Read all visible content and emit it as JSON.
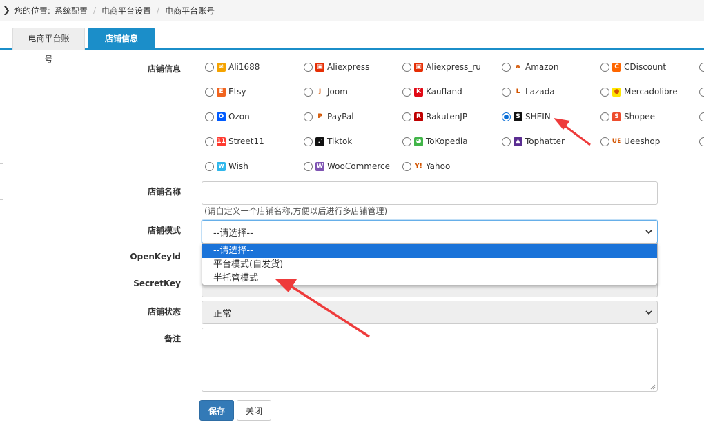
{
  "breadcrumb": {
    "prefix": "您的位置:",
    "items": [
      "系统配置",
      "电商平台设置",
      "电商平台账号"
    ]
  },
  "tabs": [
    {
      "label": "电商平台账号",
      "active": false
    },
    {
      "label": "店铺信息",
      "active": true,
      "close": "✖"
    }
  ],
  "form": {
    "platform_label": "店铺信息",
    "platforms": [
      {
        "name": "Ali1688",
        "icon": "ali1688-icon",
        "color": "#f5a300",
        "glyph": "≠"
      },
      {
        "name": "Aliexpress",
        "icon": "aliexpress-icon",
        "color": "#e62e04",
        "glyph": "▣"
      },
      {
        "name": "Aliexpress_ru",
        "icon": "aliexpress-ru-icon",
        "color": "#e62e04",
        "glyph": "▣"
      },
      {
        "name": "Amazon",
        "icon": "amazon-icon",
        "color": "#ffffff",
        "glyph": "a"
      },
      {
        "name": "CDiscount",
        "icon": "cdiscount-icon",
        "color": "#ff6600",
        "glyph": "C"
      },
      {
        "name": "Etsy",
        "icon": "etsy-icon",
        "color": "#f1641e",
        "glyph": "E"
      },
      {
        "name": "Joom",
        "icon": "joom-icon",
        "color": "#ffffff",
        "glyph": "J"
      },
      {
        "name": "Kaufland",
        "icon": "kaufland-icon",
        "color": "#e10915",
        "glyph": "K"
      },
      {
        "name": "Lazada",
        "icon": "lazada-icon",
        "color": "#ffffff",
        "glyph": "L"
      },
      {
        "name": "Mercadolibre",
        "icon": "mercadolibre-icon",
        "color": "#ffe600",
        "glyph": "●"
      },
      {
        "name": "Ozon",
        "icon": "ozon-icon",
        "color": "#005bff",
        "glyph": "O"
      },
      {
        "name": "PayPal",
        "icon": "paypal-icon",
        "color": "#ffffff",
        "glyph": "P"
      },
      {
        "name": "RakutenJP",
        "icon": "rakuten-icon",
        "color": "#bf0000",
        "glyph": "R"
      },
      {
        "name": "SHEIN",
        "icon": "shein-icon",
        "color": "#111111",
        "glyph": "S"
      },
      {
        "name": "Shopee",
        "icon": "shopee-icon",
        "color": "#ee4d2d",
        "glyph": "S"
      },
      {
        "name": "Street11",
        "icon": "street11-icon",
        "color": "#ff3b30",
        "glyph": "11"
      },
      {
        "name": "Tiktok",
        "icon": "tiktok-icon",
        "color": "#111111",
        "glyph": "♪"
      },
      {
        "name": "ToKopedia",
        "icon": "tokopedia-icon",
        "color": "#42b549",
        "glyph": "◕"
      },
      {
        "name": "Tophatter",
        "icon": "tophatter-icon",
        "color": "#5a2d91",
        "glyph": "▲"
      },
      {
        "name": "Ueeshop",
        "icon": "ueeshop-icon",
        "color": "#ffffff",
        "glyph": "UE"
      },
      {
        "name": "Wish",
        "icon": "wish-icon",
        "color": "#2fb7ec",
        "glyph": "w"
      },
      {
        "name": "WooCommerce",
        "icon": "woocommerce-icon",
        "color": "#7f54b3",
        "glyph": "W"
      },
      {
        "name": "Yahoo",
        "icon": "yahoo-icon",
        "color": "#ffffff",
        "glyph": "Y!"
      }
    ],
    "selected_platform": "SHEIN",
    "shop_name_label": "店铺名称",
    "shop_name_value": "",
    "shop_name_hint": "(请自定义一个店铺名称,方便以后进行多店铺管理)",
    "shop_mode_label": "店铺模式",
    "shop_mode_value": "--请选择--",
    "shop_mode_options": [
      "--请选择--",
      "平台模式(自发货)",
      "半托管模式"
    ],
    "open_key_label": "OpenKeyId",
    "secret_key_label": "SecretKey",
    "shop_status_label": "店铺状态",
    "shop_status_value": "正常",
    "remark_label": "备注"
  },
  "buttons": {
    "save": "保存",
    "close": "关闭"
  },
  "colors": {
    "accent": "#1b8ec9",
    "primary_button": "#337ab7",
    "dropdown_highlight": "#1a73d9",
    "annotation_arrow": "#ee3b3b"
  }
}
